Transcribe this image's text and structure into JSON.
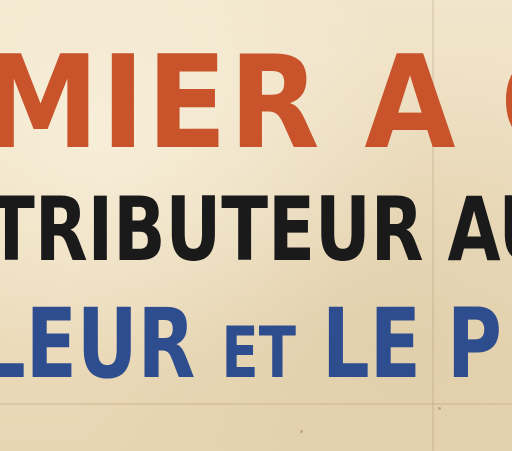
{
  "poster": {
    "line1": "MIER A CIG",
    "line2": "TRIBUTEUR AU",
    "line3_part1": "LEUR",
    "line3_part2": "ET",
    "line3_part3": "LE P"
  },
  "colors": {
    "paper": "#efe2c6",
    "red": "#c9532b",
    "black": "#1b1a1a",
    "blue": "#2e4d8f"
  }
}
